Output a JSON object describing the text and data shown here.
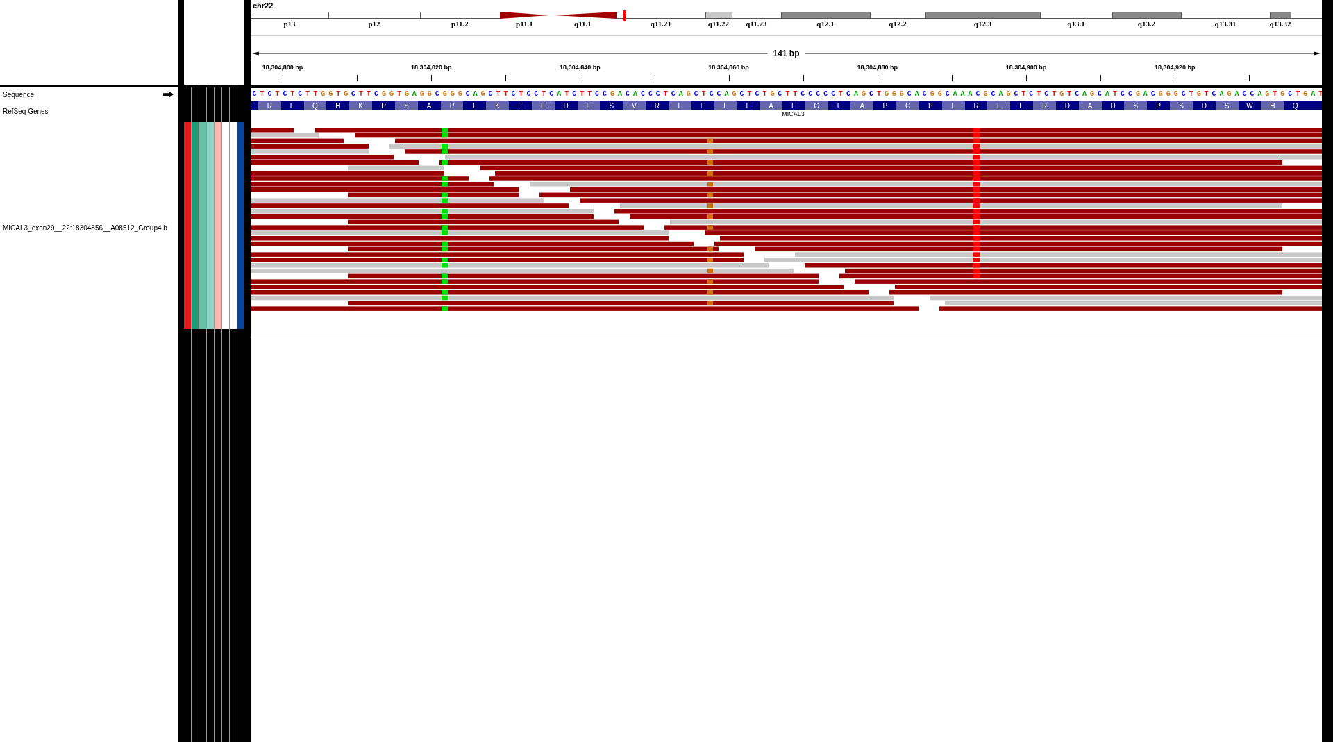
{
  "chromosome": {
    "name": "chr22",
    "bands": [
      {
        "label": "p13",
        "kind": "gneg"
      },
      {
        "label": "p12",
        "kind": "gneg"
      },
      {
        "label": "p11.2",
        "kind": "gneg"
      },
      {
        "label": "p11.1",
        "kind": "acenp"
      },
      {
        "label": "q11.1",
        "kind": "acenq"
      },
      {
        "label": "q11.21",
        "kind": "gneg"
      },
      {
        "label": "q11.22",
        "kind": "gpos25"
      },
      {
        "label": "q11.23",
        "kind": "gneg"
      },
      {
        "label": "q12.1",
        "kind": "gpos50"
      },
      {
        "label": "q12.2",
        "kind": "gneg"
      },
      {
        "label": "q12.3",
        "kind": "gpos50"
      },
      {
        "label": "q13.1",
        "kind": "gneg"
      },
      {
        "label": "q13.2",
        "kind": "gpos50"
      },
      {
        "label": "q13.31",
        "kind": "gneg"
      },
      {
        "label": "q13.32",
        "kind": "gpos50"
      },
      {
        "kind": "gneg"
      }
    ]
  },
  "ruler": {
    "span": "141 bp",
    "ticks": [
      "18,304,800 bp",
      "18,304,820 bp",
      "18,304,840 bp",
      "18,304,860 bp",
      "18,304,880 bp",
      "18,304,900 bp",
      "18,304,920 bp"
    ]
  },
  "tracks": {
    "sequence": {
      "name": "Sequence",
      "bases": "CTCTCTCTTGGTGCTTCGGTGAGGCGGGCAGCTTCTCCTCATCTTCCGACACCCTCAGCTCCAGCTCTGCTTCCCCCTCAGCTGGGCACGGCAAACGCAGCTCTCTGTCAGCATCCGACGGGCTGTCAGACCAGTGCTGAT"
    },
    "genes": {
      "name": "RefSeq Genes",
      "gene": "MICAL3",
      "amino_acids": [
        "R",
        "E",
        "Q",
        "H",
        "K",
        "P",
        "S",
        "A",
        "P",
        "L",
        "K",
        "E",
        "E",
        "D",
        "E",
        "S",
        "V",
        "R",
        "L",
        "E",
        "L",
        "E",
        "A",
        "E",
        "G",
        "E",
        "A",
        "P",
        "C",
        "P",
        "L",
        "R",
        "L",
        "E",
        "R",
        "D",
        "A",
        "D",
        "S",
        "P",
        "S",
        "D",
        "S",
        "W",
        "H",
        "Q"
      ]
    },
    "alignment": {
      "name": "MICAL3_exon29__22:18304856__A08512_Group4.b"
    }
  },
  "attributes": [
    {
      "color": "#e41a1c"
    },
    {
      "color": "#1b9e77"
    },
    {
      "color": "#66c2a5"
    },
    {
      "color": "#8dd3c7"
    },
    {
      "color": "#fbb4ae"
    },
    {
      "color": "#ffffff"
    },
    {
      "color": "#ffffff"
    },
    {
      "color": "#0b4595"
    }
  ]
}
